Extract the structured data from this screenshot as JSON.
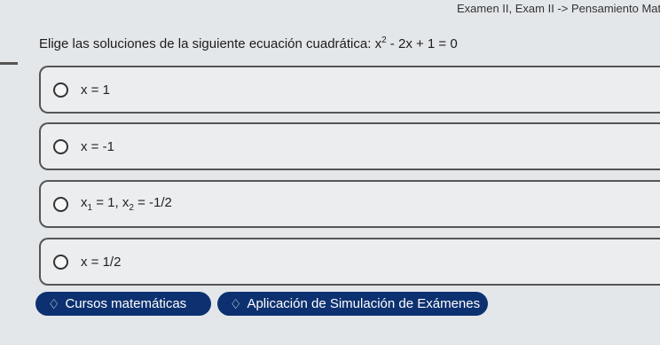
{
  "breadcrumb": "Examen II, Exam II -> Pensamiento Mat",
  "question": {
    "prefix": "Elige las soluciones de la siguiente ecuación cuadrática: ",
    "var": "x",
    "exp": "2",
    "suffix": " - 2x + 1 = 0"
  },
  "options": [
    {
      "text": "x = 1"
    },
    {
      "text": "x = -1"
    },
    {
      "sym1": "x",
      "sub1": "1",
      "mid": " = 1, ",
      "sym2": "x",
      "sub2": "2",
      "end": " = -1/2"
    },
    {
      "text": "x = 1/2"
    }
  ],
  "buttons": {
    "courses": {
      "icon": "tag-icon",
      "label": "Cursos matemáticas"
    },
    "simulation": {
      "icon": "tag-icon",
      "label": "Aplicación de Simulación de Exámenes"
    }
  }
}
